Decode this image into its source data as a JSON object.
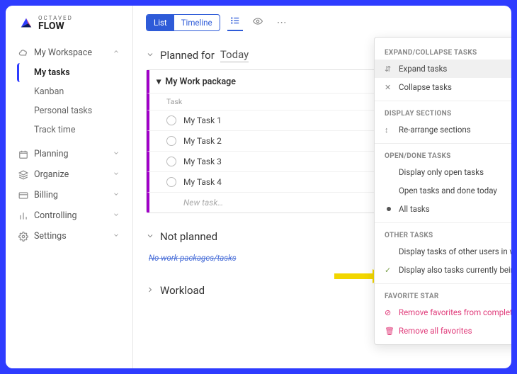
{
  "logo": {
    "top": "OCTAVED",
    "bot": "FLOW"
  },
  "sidebar": {
    "workspace": {
      "label": "My Workspace"
    },
    "sub": {
      "my_tasks": "My tasks",
      "kanban": "Kanban",
      "personal": "Personal tasks",
      "track": "Track time"
    },
    "planning": "Planning",
    "organize": "Organize",
    "billing": "Billing",
    "controlling": "Controlling",
    "settings": "Settings"
  },
  "toolbar": {
    "list": "List",
    "timeline": "Timeline"
  },
  "sections": {
    "planned": {
      "label": "Planned for",
      "date": "Today"
    },
    "not_planned": "Not planned",
    "workload": "Workload",
    "empty": "No work packages/tasks"
  },
  "wp": {
    "title": "My Work package",
    "col": "Task",
    "tasks": {
      "0": "My Task 1",
      "1": "My Task 2",
      "2": "My Task 3",
      "3": "My Task 4"
    },
    "new": "New task…"
  },
  "menu": {
    "h1": "EXPAND/COLLAPSE TASKS",
    "expand": "Expand tasks",
    "collapse": "Collapse tasks",
    "h2": "DISPLAY SECTIONS",
    "rearrange": "Re-arrange sections",
    "h3": "OPEN/DONE TASKS",
    "open_only": "Display only open tasks",
    "open_today": "Open tasks and done today",
    "all": "All tasks",
    "h4": "OTHER TASKS",
    "other_users": "Display tasks of other users in work packages",
    "blocked": "Display also tasks currently being blocked",
    "h5": "FAVORITE STAR",
    "remove_completed": "Remove favorites from completed work packages",
    "remove_all": "Remove all favorites"
  }
}
